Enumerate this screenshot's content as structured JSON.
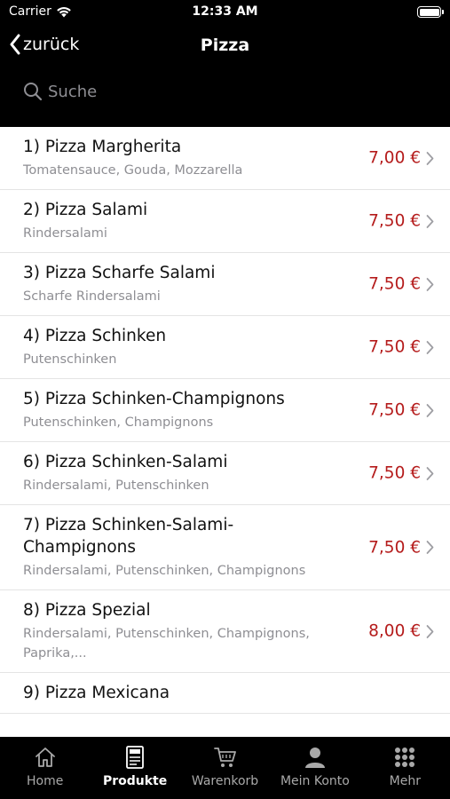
{
  "status_bar": {
    "carrier": "Carrier",
    "time": "12:33 AM"
  },
  "nav": {
    "back_label": "zurück",
    "title": "Pizza"
  },
  "search": {
    "placeholder": "Suche"
  },
  "products": [
    {
      "name": "1) Pizza Margherita",
      "description": "Tomatensauce, Gouda, Mozzarella",
      "price": "7,00 €"
    },
    {
      "name": "2) Pizza Salami",
      "description": "Rindersalami",
      "price": "7,50 €"
    },
    {
      "name": "3) Pizza Scharfe Salami",
      "description": "Scharfe Rindersalami",
      "price": "7,50 €"
    },
    {
      "name": "4) Pizza Schinken",
      "description": "Putenschinken",
      "price": "7,50 €"
    },
    {
      "name": "5) Pizza Schinken-Champignons",
      "description": "Putenschinken, Champignons",
      "price": "7,50 €"
    },
    {
      "name": "6) Pizza Schinken-Salami",
      "description": "Rindersalami, Putenschinken",
      "price": "7,50 €"
    },
    {
      "name": "7) Pizza Schinken-Salami-Champignons",
      "description": "Rindersalami, Putenschinken, Champignons",
      "price": "7,50 €"
    },
    {
      "name": "8) Pizza Spezial",
      "description": "Rindersalami, Putenschinken, Champignons, Paprika,...",
      "price": "8,00 €"
    },
    {
      "name": "9) Pizza Mexicana",
      "description": "",
      "price": ""
    }
  ],
  "tabbar": [
    {
      "label": "Home",
      "icon": "home-icon",
      "active": false
    },
    {
      "label": "Produkte",
      "icon": "menu-card-icon",
      "active": true
    },
    {
      "label": "Warenkorb",
      "icon": "cart-icon",
      "active": false
    },
    {
      "label": "Mein Konto",
      "icon": "person-icon",
      "active": false
    },
    {
      "label": "Mehr",
      "icon": "grid-icon",
      "active": false
    }
  ],
  "colors": {
    "header_bg": "#000000",
    "price": "#b51c1c",
    "tab_active": "#ffffff",
    "tab_inactive": "#a9a9a9"
  }
}
